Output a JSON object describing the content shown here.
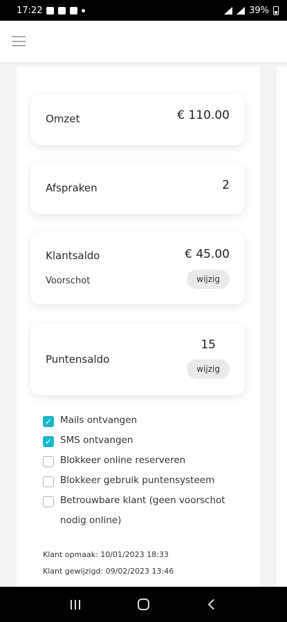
{
  "status_bar": {
    "time": "17:22",
    "battery": "39%"
  },
  "header": {
    "menu_icon": "hamburger-menu-icon"
  },
  "cards": {
    "omzet": {
      "label": "Omzet",
      "value": "€ 110.00"
    },
    "afspraken": {
      "label": "Afspraken",
      "value": "2"
    },
    "klantsaldo": {
      "label": "Klantsaldo",
      "value": "€ 45.00",
      "sub_label": "Voorschot",
      "button": "wijzig"
    },
    "puntensaldo": {
      "label": "Puntensaldo",
      "value": "15",
      "button": "wijzig"
    }
  },
  "options": [
    {
      "label": "Mails ontvangen",
      "checked": true
    },
    {
      "label": "SMS ontvangen",
      "checked": true
    },
    {
      "label": "Blokkeer online reserveren",
      "checked": false
    },
    {
      "label": "Blokkeer gebruik puntensysteem",
      "checked": false
    },
    {
      "label": "Betrouwbare klant (geen voorschot nodig online)",
      "checked": false
    }
  ],
  "meta": {
    "created": "Klant opmaak: 10/01/2023 18:33",
    "modified": "Klant gewijzigd: 09/02/2023 13:46"
  },
  "colors": {
    "accent": "#17b8c7",
    "pill": "#e9e9e9"
  }
}
